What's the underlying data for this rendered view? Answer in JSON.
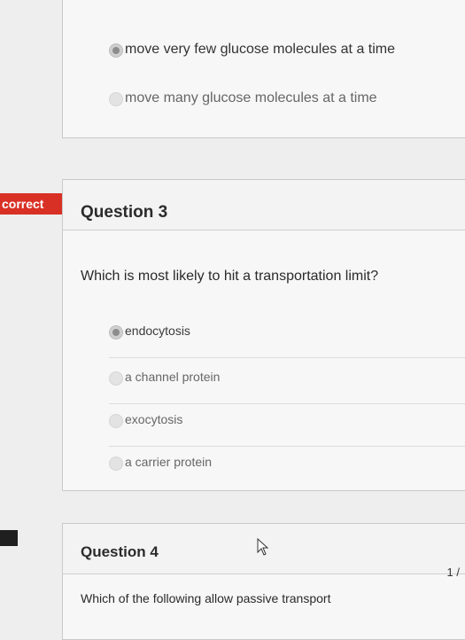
{
  "previous_question": {
    "answers": [
      {
        "label": "move very few glucose molecules at a time",
        "selected": true
      },
      {
        "label": "move many glucose molecules at a time",
        "selected": false
      }
    ]
  },
  "badge": {
    "label": "correct",
    "color": "#d93025"
  },
  "question3": {
    "title": "Question 3",
    "text": "Which is most likely to hit a transportation limit?",
    "answers": [
      {
        "label": "endocytosis",
        "selected": true
      },
      {
        "label": "a channel protein",
        "selected": false
      },
      {
        "label": "exocytosis",
        "selected": false
      },
      {
        "label": "a carrier protein",
        "selected": false
      }
    ]
  },
  "question4": {
    "title": "Question 4",
    "text": "Which of the following allow passive transport",
    "score": "1 /"
  },
  "icons": {
    "cursor": "mouse-pointer-icon",
    "arrow": "arrow-right-icon"
  }
}
